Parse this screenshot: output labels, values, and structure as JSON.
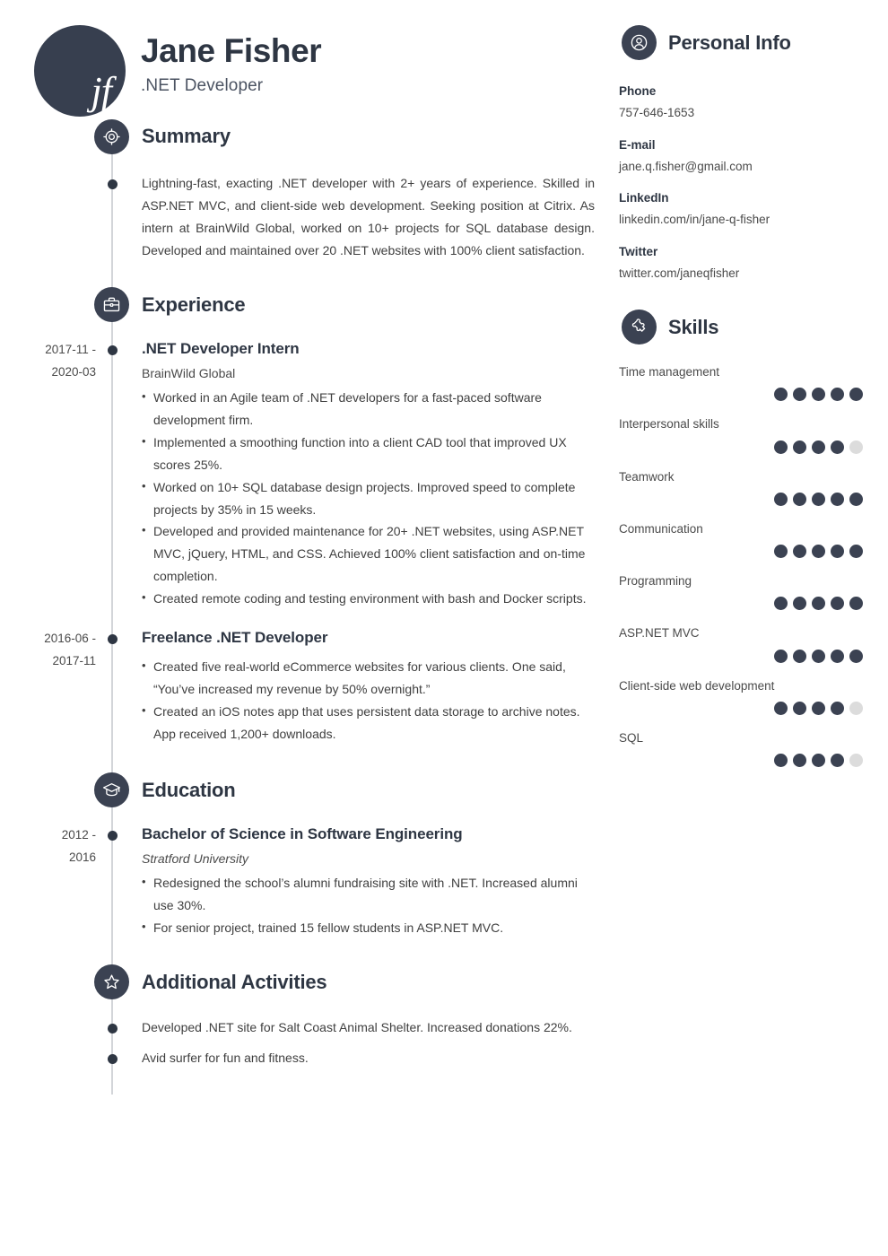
{
  "theme": {
    "accent_dark": "#373f4f",
    "icon_bg": "#3b4252",
    "heading_color": "#2e3643",
    "body_color": "#3f3f3f",
    "rail_color": "#d3d5d9",
    "dot_filled": "#3b4252",
    "dot_empty": "#dcdcdc",
    "page_bg": "#ffffff"
  },
  "header": {
    "monogram": "jf",
    "name": "Jane Fisher",
    "job_title": ".NET Developer"
  },
  "sections": {
    "summary": {
      "title": "Summary",
      "icon": "target-icon",
      "text": "Lightning-fast, exacting .NET developer with 2+ years of experience. Skilled in ASP.NET MVC, and client-side web development. Seeking position at Citrix. As intern at BrainWild Global, worked on 10+ projects for SQL database design. Developed and maintained over 20 .NET websites with 100% client satisfaction."
    },
    "experience": {
      "title": "Experience",
      "icon": "briefcase-icon",
      "entries": [
        {
          "date": "2017-11 - 2020-03",
          "date_line1": "2017-11 -",
          "date_line2": "2020-03",
          "title": ".NET Developer Intern",
          "company": "BrainWild Global",
          "bullets": [
            "Worked in an Agile team of .NET developers for a fast-paced software development firm.",
            "Implemented a smoothing function into a client CAD tool that improved UX scores 25%.",
            "Worked on 10+ SQL database design projects. Improved speed to complete projects by 35% in 15 weeks.",
            "Developed and provided maintenance for 20+ .NET websites, using ASP.NET MVC, jQuery, HTML, and CSS. Achieved 100% client satisfaction and on-time completion.",
            "Created remote coding and testing environment with bash and Docker scripts."
          ]
        },
        {
          "date": "2016-06 - 2017-11",
          "date_line1": "2016-06 -",
          "date_line2": "2017-11",
          "title": "Freelance .NET Developer",
          "company": "",
          "bullets": [
            "Created five real-world eCommerce websites for various clients. One said, “You’ve increased my revenue by 50% overnight.”",
            "Created an iOS notes app that uses persistent data storage to archive notes. App received 1,200+ downloads."
          ]
        }
      ]
    },
    "education": {
      "title": "Education",
      "icon": "graduation-cap-icon",
      "entries": [
        {
          "date": "2012 - 2016",
          "date_line1": "2012 -",
          "date_line2": "2016",
          "title": "Bachelor of Science in Software Engineering",
          "school": "Stratford University",
          "bullets": [
            "Redesigned the school’s alumni fundraising site with .NET. Increased alumni use 30%.",
            "For senior project, trained 15 fellow students in ASP.NET MVC."
          ]
        }
      ]
    },
    "additional_activities": {
      "title": "Additional Activities",
      "icon": "star-icon",
      "items": [
        "Developed .NET site for Salt Coast Animal Shelter. Increased donations 22%.",
        "Avid surfer for fun and fitness."
      ]
    }
  },
  "sidebar": {
    "personal_info": {
      "title": "Personal Info",
      "icon": "person-icon",
      "items": [
        {
          "label": "Phone",
          "value": "757-646-1653"
        },
        {
          "label": "E-mail",
          "value": "jane.q.fisher@gmail.com"
        },
        {
          "label": "LinkedIn",
          "value": "linkedin.com/in/jane-q-fisher"
        },
        {
          "label": "Twitter",
          "value": "twitter.com/janeqfisher"
        }
      ]
    },
    "skills": {
      "title": "Skills",
      "icon": "puzzle-icon",
      "max_rating": 5,
      "items": [
        {
          "name": "Time management",
          "rating": 5
        },
        {
          "name": "Interpersonal skills",
          "rating": 4
        },
        {
          "name": "Teamwork",
          "rating": 5
        },
        {
          "name": "Communication",
          "rating": 5
        },
        {
          "name": "Programming",
          "rating": 5
        },
        {
          "name": "ASP.NET MVC",
          "rating": 5
        },
        {
          "name": "Client-side web development",
          "rating": 4
        },
        {
          "name": "SQL",
          "rating": 4
        }
      ]
    }
  }
}
